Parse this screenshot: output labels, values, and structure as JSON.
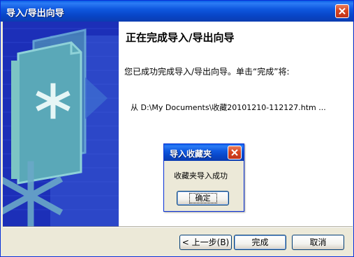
{
  "wizard": {
    "title": "导入/导出向导",
    "heading": "正在完成导入/导出向导",
    "description": "您已成功完成导入/导出向导。单击“完成”将:",
    "detail": "从 D:\\My Documents\\收藏20101210-112127.htm ...",
    "buttons": {
      "back": "< 上一步(B)",
      "finish": "完成",
      "cancel": "取消"
    }
  },
  "message_box": {
    "title": "导入收藏夹",
    "text": "收藏夹导入成功",
    "ok": "确定"
  },
  "icons": {
    "close": "close-icon",
    "wizard_art": "documents-asterisk-graphic"
  },
  "colors": {
    "titlebar": "#0846c8",
    "side_panel": "#1c2fb8",
    "close": "#d6451f"
  }
}
